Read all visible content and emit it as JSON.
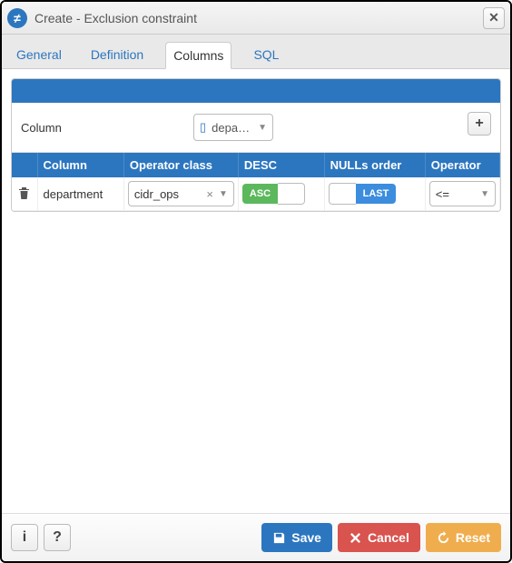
{
  "title": "Create - Exclusion constraint",
  "tabs": [
    "General",
    "Definition",
    "Columns",
    "SQL"
  ],
  "active_tab_index": 2,
  "column_picker": {
    "label": "Column",
    "selected": "depa…"
  },
  "grid": {
    "headers": [
      "",
      "Column",
      "Operator class",
      "DESC",
      "NULLs order",
      "Operator"
    ],
    "rows": [
      {
        "column": "department",
        "operator_class": "cidr_ops",
        "desc_badge": "ASC",
        "nulls_badge": "LAST",
        "operator": "<="
      }
    ]
  },
  "buttons": {
    "save": "Save",
    "cancel": "Cancel",
    "reset": "Reset"
  }
}
